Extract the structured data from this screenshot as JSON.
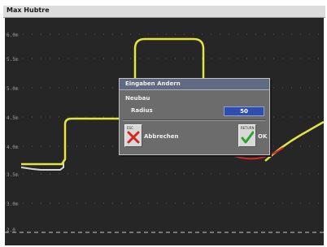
{
  "menubar": {
    "title": "Max  Hubtre"
  },
  "axis": {
    "labels": [
      "6.0m",
      "5.5m",
      "5.0m",
      "4.5m",
      "4.0m",
      "3.5m",
      "3.0m",
      "2.0"
    ]
  },
  "dialog": {
    "title": "Eingaben Andern",
    "subtitle": "Neubau",
    "field_label": "Radius",
    "field_value": "50",
    "cancel_label": "Abbrechen",
    "ok_label": "OK",
    "cancel_icon_caption": "ESC",
    "ok_icon_caption": "RETURN"
  },
  "colors": {
    "plot_bg": "#262626",
    "yellow_line": "#e3e341",
    "white_line": "#d7d7d7",
    "red_line": "#d02a2a",
    "dashed_line": "#c8c8c8"
  },
  "icons": {
    "cancel": "red-x-icon",
    "ok": "green-check-icon"
  }
}
